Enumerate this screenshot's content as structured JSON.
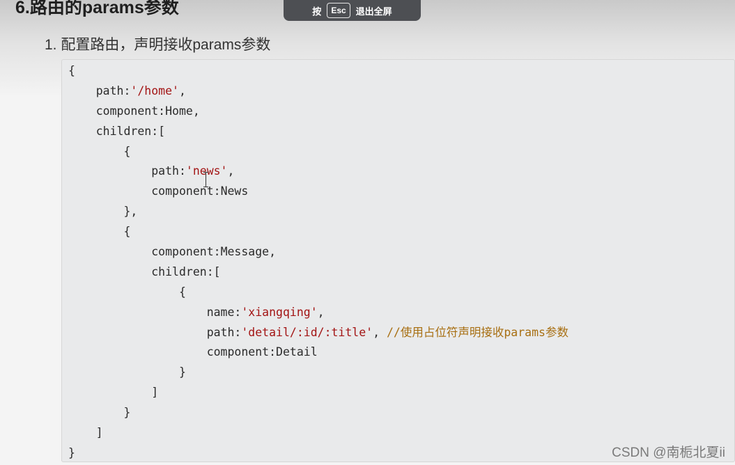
{
  "heading": "6.路由的params参数",
  "fullscreen_tip": {
    "prefix": "按",
    "key": "Esc",
    "suffix": "退出全屏"
  },
  "step": {
    "number": "1.",
    "text": "配置路由，声明接收params参数"
  },
  "code": {
    "lines": [
      {
        "indent": 0,
        "key": "",
        "value": "{",
        "string": "",
        "trail": "",
        "comment": ""
      },
      {
        "indent": 1,
        "key": "path:",
        "string": "'/home'",
        "value": "",
        "trail": ",",
        "comment": ""
      },
      {
        "indent": 1,
        "key": "component:",
        "string": "",
        "value": "Home",
        "trail": ",",
        "comment": ""
      },
      {
        "indent": 1,
        "key": "children:",
        "string": "",
        "value": "[",
        "trail": "",
        "comment": ""
      },
      {
        "indent": 2,
        "key": "",
        "string": "",
        "value": "{",
        "trail": "",
        "comment": ""
      },
      {
        "indent": 3,
        "key": "path:",
        "string": "'news'",
        "value": "",
        "trail": ",",
        "comment": ""
      },
      {
        "indent": 3,
        "key": "component:",
        "string": "",
        "value": "News",
        "trail": "",
        "comment": ""
      },
      {
        "indent": 2,
        "key": "",
        "string": "",
        "value": "},",
        "trail": "",
        "comment": ""
      },
      {
        "indent": 2,
        "key": "",
        "string": "",
        "value": "{",
        "trail": "",
        "comment": ""
      },
      {
        "indent": 3,
        "key": "component:",
        "string": "",
        "value": "Message",
        "trail": ",",
        "comment": ""
      },
      {
        "indent": 3,
        "key": "children:",
        "string": "",
        "value": "[",
        "trail": "",
        "comment": ""
      },
      {
        "indent": 4,
        "key": "",
        "string": "",
        "value": "{",
        "trail": "",
        "comment": ""
      },
      {
        "indent": 5,
        "key": "name:",
        "string": "'xiangqing'",
        "value": "",
        "trail": ",",
        "comment": ""
      },
      {
        "indent": 5,
        "key": "path:",
        "string": "'detail/:id/:title'",
        "value": "",
        "trail": ", ",
        "comment": "//使用占位符声明接收params参数"
      },
      {
        "indent": 5,
        "key": "component:",
        "string": "",
        "value": "Detail",
        "trail": "",
        "comment": ""
      },
      {
        "indent": 4,
        "key": "",
        "string": "",
        "value": "}",
        "trail": "",
        "comment": ""
      },
      {
        "indent": 3,
        "key": "",
        "string": "",
        "value": "]",
        "trail": "",
        "comment": ""
      },
      {
        "indent": 2,
        "key": "",
        "string": "",
        "value": "}",
        "trail": "",
        "comment": ""
      },
      {
        "indent": 1,
        "key": "",
        "string": "",
        "value": "]",
        "trail": "",
        "comment": ""
      },
      {
        "indent": 0,
        "key": "",
        "string": "",
        "value": "}",
        "trail": "",
        "comment": ""
      }
    ]
  },
  "watermark": "CSDN @南栀北夏ii"
}
